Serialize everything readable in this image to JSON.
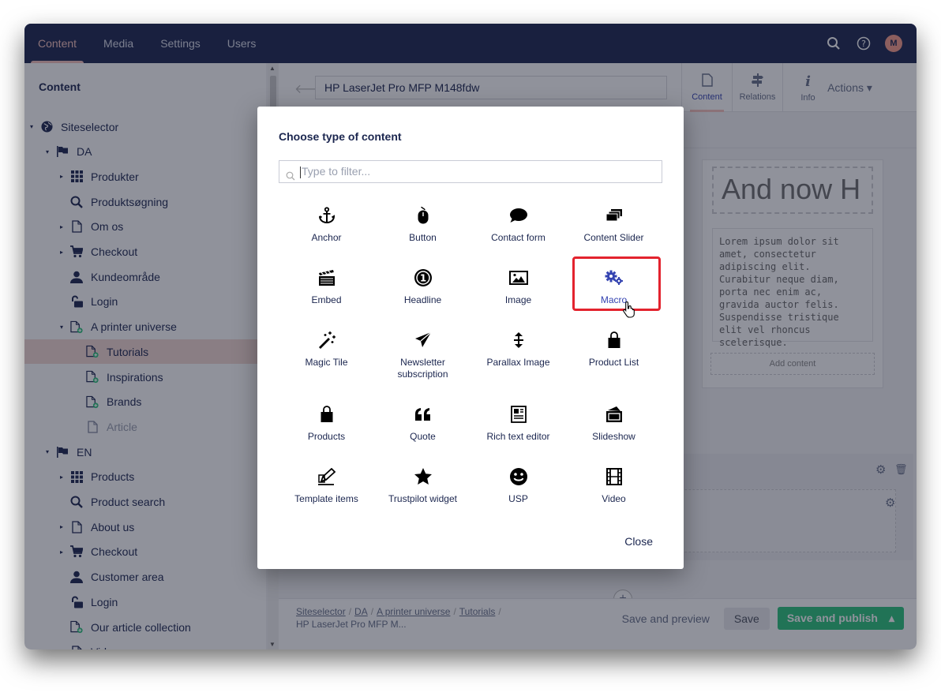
{
  "topnav": {
    "tabs": [
      "Content",
      "Media",
      "Settings",
      "Users"
    ],
    "avatar_initial": "M"
  },
  "tree": {
    "title": "Content",
    "items": [
      {
        "label": "Siteselector",
        "icon": "globe-icon",
        "level": 0,
        "caret": true
      },
      {
        "label": "DA",
        "icon": "flag-icon",
        "level": 1,
        "caret": true
      },
      {
        "label": "Produkter",
        "icon": "grid-icon",
        "level": 2,
        "caret": true
      },
      {
        "label": "Produktsøgning",
        "icon": "search-icon",
        "level": 2,
        "caret": false
      },
      {
        "label": "Om os",
        "icon": "document-icon",
        "level": 2,
        "caret": true
      },
      {
        "label": "Checkout",
        "icon": "cart-icon",
        "level": 2,
        "caret": true
      },
      {
        "label": "Kundeområde",
        "icon": "user-icon",
        "level": 2,
        "caret": false
      },
      {
        "label": "Login",
        "icon": "unlock-icon",
        "level": 2,
        "caret": false
      },
      {
        "label": "A printer universe",
        "icon": "document-plus-icon",
        "level": 2,
        "caret": true
      },
      {
        "label": "Tutorials",
        "icon": "document-plus-icon",
        "level": 3,
        "caret": false,
        "selected": true
      },
      {
        "label": "Inspirations",
        "icon": "document-plus-icon",
        "level": 3,
        "caret": false
      },
      {
        "label": "Brands",
        "icon": "document-plus-icon",
        "level": 3,
        "caret": false
      },
      {
        "label": "Article",
        "icon": "document-icon",
        "level": 3,
        "caret": false,
        "muted": true
      },
      {
        "label": "EN",
        "icon": "flag-icon",
        "level": 1,
        "caret": true
      },
      {
        "label": "Products",
        "icon": "grid-icon",
        "level": 2,
        "caret": true
      },
      {
        "label": "Product search",
        "icon": "search-icon",
        "level": 2,
        "caret": false
      },
      {
        "label": "About us",
        "icon": "document-icon",
        "level": 2,
        "caret": true
      },
      {
        "label": "Checkout",
        "icon": "cart-icon",
        "level": 2,
        "caret": true
      },
      {
        "label": "Customer area",
        "icon": "user-icon",
        "level": 2,
        "caret": false
      },
      {
        "label": "Login",
        "icon": "unlock-icon",
        "level": 2,
        "caret": false
      },
      {
        "label": "Our article collection",
        "icon": "document-plus-icon",
        "level": 2,
        "caret": false
      },
      {
        "label": "Video page",
        "icon": "document-icon",
        "level": 2,
        "caret": false
      }
    ]
  },
  "editor": {
    "node_name": "HP LaserJet Pro MFP M148fdw",
    "apps": [
      {
        "label": "Content",
        "icon": "document-icon"
      },
      {
        "label": "Relations",
        "icon": "signpost-icon"
      },
      {
        "label": "Info",
        "icon": "info-icon"
      }
    ],
    "actions_label": "Actions ▾",
    "preview_heading": "And now H",
    "preview_text": "Lorem ipsum dolor sit amet, consectetur adipiscing elit. Curabitur neque diam, porta nec enim ac, gravida auctor felis. Suspendisse tristique elit vel rhoncus scelerisque.",
    "add_content": "Add content",
    "breadcrumb": [
      "Siteselector",
      "DA",
      "A printer universe",
      "Tutorials"
    ],
    "breadcrumb_current": "HP LaserJet Pro MFP M...",
    "save_preview": "Save and preview",
    "save": "Save",
    "save_publish": "Save and publish"
  },
  "dialog": {
    "title": "Choose type of content",
    "filter_placeholder": "Type to filter...",
    "close": "Close",
    "items": [
      {
        "label": "Anchor",
        "icon": "anchor-icon"
      },
      {
        "label": "Button",
        "icon": "mouse-icon"
      },
      {
        "label": "Contact form",
        "icon": "speech-bubble-icon"
      },
      {
        "label": "Content Slider",
        "icon": "stack-icon"
      },
      {
        "label": "Embed",
        "icon": "clapperboard-icon"
      },
      {
        "label": "Headline",
        "icon": "number-one-icon"
      },
      {
        "label": "Image",
        "icon": "picture-icon"
      },
      {
        "label": "Macro",
        "icon": "gears-icon",
        "hover": true
      },
      {
        "label": "Magic Tile",
        "icon": "magic-wand-icon"
      },
      {
        "label": "Newsletter subscription",
        "icon": "paper-plane-icon"
      },
      {
        "label": "Parallax Image",
        "icon": "vertical-arrows-icon"
      },
      {
        "label": "Product List",
        "icon": "shopping-bag-icon"
      },
      {
        "label": "Products",
        "icon": "shopping-bag-icon"
      },
      {
        "label": "Quote",
        "icon": "quote-icon"
      },
      {
        "label": "Rich text editor",
        "icon": "newspaper-icon"
      },
      {
        "label": "Slideshow",
        "icon": "slides-icon"
      },
      {
        "label": "Template items",
        "icon": "pen-edit-icon"
      },
      {
        "label": "Trustpilot widget",
        "icon": "star-icon"
      },
      {
        "label": "USP",
        "icon": "smiley-icon"
      },
      {
        "label": "Video",
        "icon": "film-icon"
      }
    ]
  },
  "colors": {
    "topbar": "#1b264f",
    "accent_pink": "#f5c1bc",
    "highlight_red": "#e3232e",
    "publish_green": "#2bc37c",
    "link_blue": "#3544b1"
  }
}
